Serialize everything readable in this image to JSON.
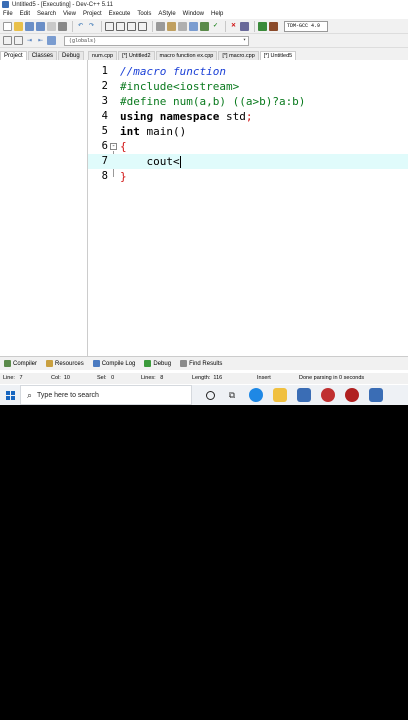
{
  "window": {
    "title": "Untitled5 - [Executing] - Dev-C++ 5.11"
  },
  "menu": [
    "File",
    "Edit",
    "Search",
    "View",
    "Project",
    "Execute",
    "Tools",
    "AStyle",
    "Window",
    "Help"
  ],
  "toolbar": {
    "compiler": "TDM-GCC 4.9"
  },
  "scope": {
    "value": "(globals)"
  },
  "panel_tabs": [
    "Project",
    "Classes",
    "Debug"
  ],
  "file_tabs": [
    "num.cpp",
    "[*] Untitled2",
    "macro function ex.cpp",
    "[*] macro.cpp",
    "[*] Untitled5"
  ],
  "editor": {
    "lines": [
      {
        "num": "1",
        "text": "//macro function"
      },
      {
        "num": "2",
        "text": "#include<iostream>"
      },
      {
        "num": "3",
        "text": "#define num(a,b) ((a>b)?a:b)"
      },
      {
        "num": "4",
        "kw": "using namespace",
        "rest": " std",
        "sym": ";"
      },
      {
        "num": "5",
        "kw": "int",
        "rest": " main()"
      },
      {
        "num": "6",
        "text": "{"
      },
      {
        "num": "7",
        "text": "    cout<"
      },
      {
        "num": "8",
        "text": "}"
      }
    ]
  },
  "bottom_tabs": [
    "Compiler",
    "Resources",
    "Compile Log",
    "Debug",
    "Find Results"
  ],
  "status": {
    "line_label": "Line:",
    "line": "7",
    "col_label": "Col:",
    "col": "10",
    "sel_label": "Sel:",
    "sel": "0",
    "lines_label": "Lines:",
    "lines": "8",
    "length_label": "Length:",
    "length": "116",
    "mode": "Insert",
    "message": "Done parsing in 0 seconds"
  },
  "taskbar": {
    "search_placeholder": "Type here to search"
  },
  "colors": {
    "comment": "#1a3fd6",
    "preprocessor": "#0a7a1e",
    "brace": "#d01010",
    "current_line": "#e0fbfb"
  }
}
